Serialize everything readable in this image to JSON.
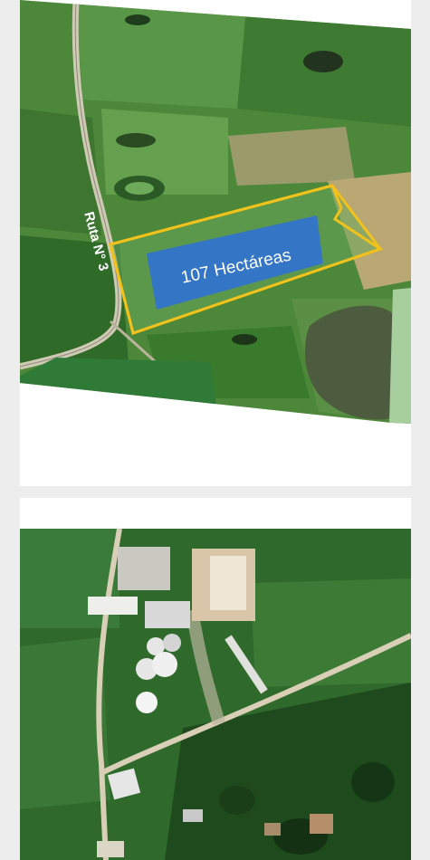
{
  "aerial_1": {
    "road_label": "Ruta N° 3",
    "area_label": "107 Hectáreas",
    "colors": {
      "outline": "#f2c21a",
      "label_bg": "#2f6fd6",
      "field_green": "#4f8f3a",
      "lagoon": "#4d5b3e"
    }
  },
  "aerial_2": {
    "colors": {
      "vegetation": "#2d6b2c",
      "road": "#d8cfb6",
      "building": "#e6e6e6"
    }
  }
}
